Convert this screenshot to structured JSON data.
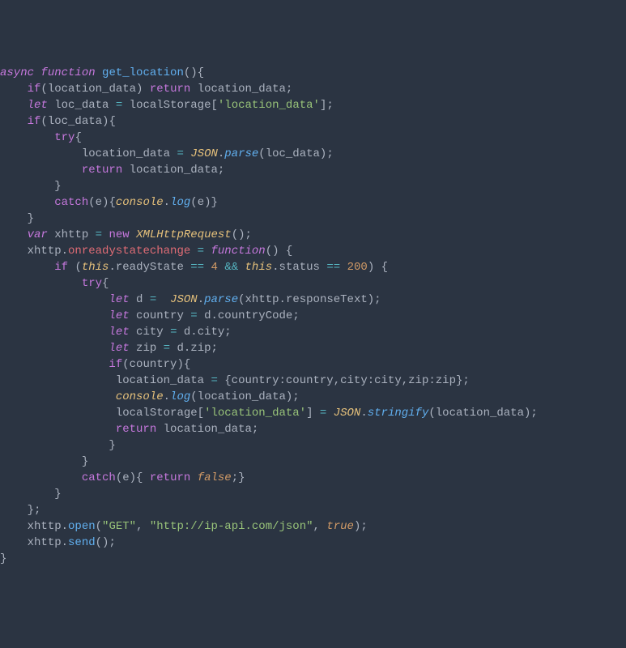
{
  "code_lines": [
    "async function get_location(){",
    "    if(location_data) return location_data;",
    "    let loc_data = localStorage['location_data'];",
    "    if(loc_data){",
    "        try{",
    "            location_data = JSON.parse(loc_data);",
    "            return location_data;",
    "        }",
    "        catch(e){console.log(e)}",
    "    }",
    "    var xhttp = new XMLHttpRequest();",
    "    xhttp.onreadystatechange = function() {",
    "        if (this.readyState == 4 && this.status == 200) {",
    "            try{",
    "                let d =  JSON.parse(xhttp.responseText);",
    "                let country = d.countryCode;",
    "                let city = d.city;",
    "                let zip = d.zip;",
    "                if(country){",
    "                 location_data = {country:country,city:city,zip:zip};",
    "                 console.log(location_data);",
    "                 localStorage['location_data'] = JSON.stringify(location_data);",
    "                 return location_data;",
    "                }",
    "            }",
    "            catch(e){ return false;}",
    "        }",
    "    };",
    "    xhttp.open(\"GET\", \"http://ip-api.com/json\", true);",
    "    xhttp.send();",
    "}"
  ],
  "tokens": {
    "keywords": [
      "async",
      "function",
      "if",
      "return",
      "let",
      "try",
      "catch",
      "var",
      "new",
      "this"
    ],
    "identifiers": [
      "get_location",
      "location_data",
      "loc_data",
      "localStorage",
      "JSON",
      "parse",
      "e",
      "console",
      "log",
      "xhttp",
      "XMLHttpRequest",
      "onreadystatechange",
      "readyState",
      "status",
      "d",
      "responseText",
      "country",
      "countryCode",
      "city",
      "zip",
      "stringify",
      "open",
      "send"
    ],
    "strings": [
      "'location_data'",
      "\"GET\"",
      "\"http://ip-api.com/json\""
    ],
    "numbers": [
      "4",
      "200"
    ],
    "booleans": [
      "true",
      "false"
    ]
  }
}
